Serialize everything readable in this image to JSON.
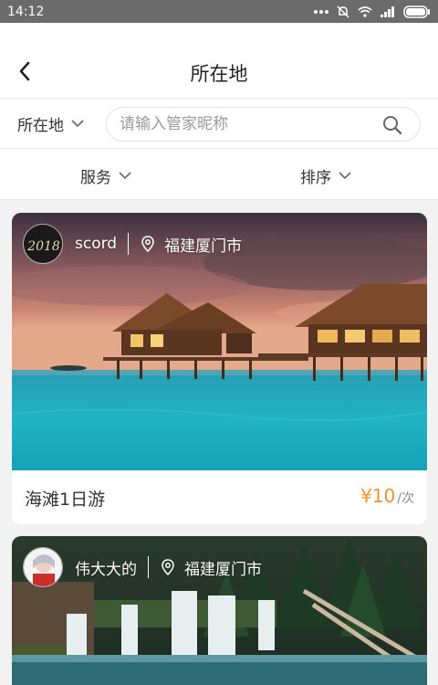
{
  "status_bar": {
    "time": "14:12"
  },
  "header": {
    "title": "所在地"
  },
  "search_row": {
    "location_label": "所在地",
    "search_placeholder": "请输入管家昵称"
  },
  "filters": {
    "service": "服务",
    "sort": "排序"
  },
  "cards": [
    {
      "guide_name": "scord",
      "location": "福建厦门市",
      "avatar_text": "2018",
      "title": "海滩1日游",
      "price": "¥10",
      "unit": "/次"
    },
    {
      "guide_name": "伟大大的",
      "location": "福建厦门市"
    }
  ],
  "colors": {
    "price": "#f0932b",
    "status_bar": "#6b6b6b"
  }
}
